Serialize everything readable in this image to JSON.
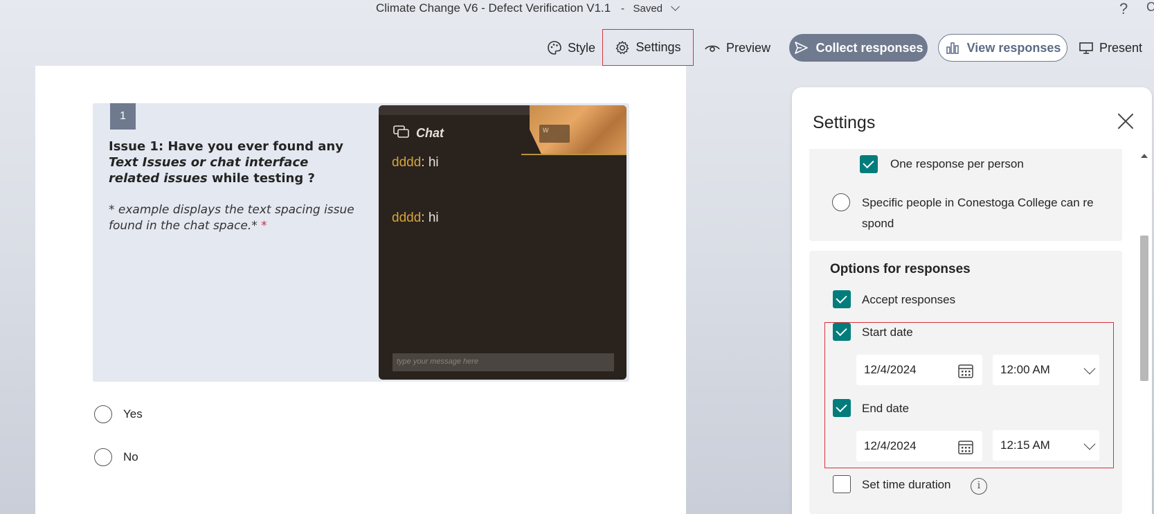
{
  "header": {
    "doc_title": "Climate Change V6 - Defect Verification V1.1",
    "separator": "-",
    "saved_label": "Saved",
    "help_symbol": "?",
    "corner_glyph": "C"
  },
  "toolbar": {
    "style_label": "Style",
    "settings_label": "Settings",
    "preview_label": "Preview",
    "collect_label": "Collect responses",
    "view_label": "View responses",
    "present_label": "Present",
    "accent_color": "#6f7a8f"
  },
  "question": {
    "number": "1",
    "issue_prefix": "Issue 1",
    "text_a": ": Have you ever found any ",
    "text_italic": "Text Issues or chat interface related issues",
    "text_b": " while testing ?",
    "subtitle": "* example displays the text spacing issue found in the chat space.*",
    "required_mark": "*",
    "image": {
      "chat_title": "Chat",
      "wood_label": "W",
      "messages": [
        {
          "name": "dddd",
          "text": ": hi"
        },
        {
          "name": "dddd",
          "text": ": hi"
        }
      ],
      "input_placeholder": "type your message here"
    },
    "options": [
      "Yes",
      "No"
    ]
  },
  "settings_panel": {
    "title": "Settings",
    "who_can_respond": {
      "one_response_label": "One response per person",
      "one_response_checked": true,
      "specific_people_label": "Specific people in Conestoga College can re spond"
    },
    "options_heading": "Options for responses",
    "accept_responses_label": "Accept responses",
    "accept_responses_checked": true,
    "start_date_label": "Start date",
    "start_date_checked": true,
    "start_date_value": "12/4/2024",
    "start_time_value": "12:00 AM",
    "end_date_label": "End date",
    "end_date_checked": true,
    "end_date_value": "12/4/2024",
    "end_time_value": "12:15 AM",
    "time_duration_label": "Set time duration",
    "time_duration_checked": false,
    "info_symbol": "i",
    "check_color": "#037c7c"
  }
}
